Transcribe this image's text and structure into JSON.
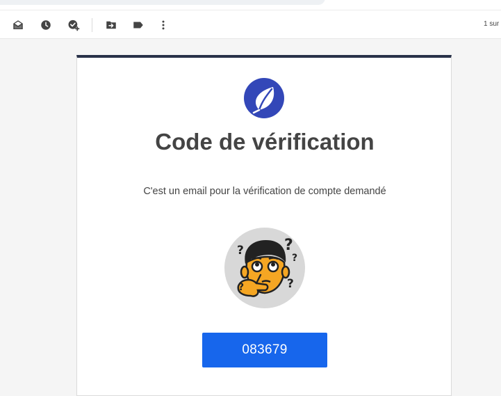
{
  "toolbar": {
    "icons": [
      "mark-unread-icon",
      "snooze-icon",
      "add-task-icon",
      "move-to-icon",
      "label-icon",
      "more-vert-icon"
    ],
    "pager_text": "1 sur"
  },
  "email": {
    "title": "Code de vérification",
    "subtitle": "C'est un email pour la vérification de compte demandé",
    "code": "083679"
  },
  "colors": {
    "header_bar": "#293249",
    "logo": "#3347b8",
    "code_button": "#1766ec",
    "title_text": "#444444"
  }
}
